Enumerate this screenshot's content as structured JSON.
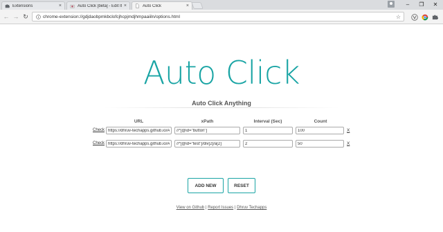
{
  "browser": {
    "tabs": [
      {
        "title": "Extensions",
        "icon": "puzzle-icon",
        "active": false
      },
      {
        "title": "Auto Click [beta] - Edit It",
        "icon": "webstore-icon",
        "active": false
      },
      {
        "title": "Auto Click",
        "icon": "page-icon",
        "active": true
      }
    ],
    "tab_close": "×",
    "window_controls": {
      "minimize": "–",
      "maximize": "❐",
      "close": "✕"
    },
    "nav": {
      "back": "←",
      "forward": "→",
      "reload": "↻"
    },
    "address": "chrome-extension://gdjdaobpmkbclofcjhcpjmdjhmpaaiiln/options.html",
    "star": "☆"
  },
  "page": {
    "logo": "Auto Click",
    "subtitle": "Auto Click Anything",
    "columns": {
      "url": "URL",
      "xpath": "xPath",
      "interval": "Interval (Sec)",
      "count": "Count"
    },
    "check_label": "Check",
    "remove_label": "X",
    "rows": [
      {
        "url": "https://dhruv-techapps.github.io/AutoClick/",
        "xpath": "//*[@id=\"button\"]",
        "interval": "1",
        "count": "100"
      },
      {
        "url": "https://dhruv-techapps.github.io/AutoClick/",
        "xpath": "//*[@id=\"test\"]/div[2]/a[2]",
        "interval": "2",
        "count": "50"
      }
    ],
    "buttons": {
      "add": "ADD NEW",
      "reset": "RESET"
    },
    "footer": {
      "github": "View on Github",
      "separator": " | ",
      "issues": "Report Issues",
      "author": "Dhruv Techapps"
    }
  },
  "colors": {
    "accent": "#19a4a4",
    "tabstrip": "#dadcdf",
    "toolbar": "#f3f3f3"
  }
}
